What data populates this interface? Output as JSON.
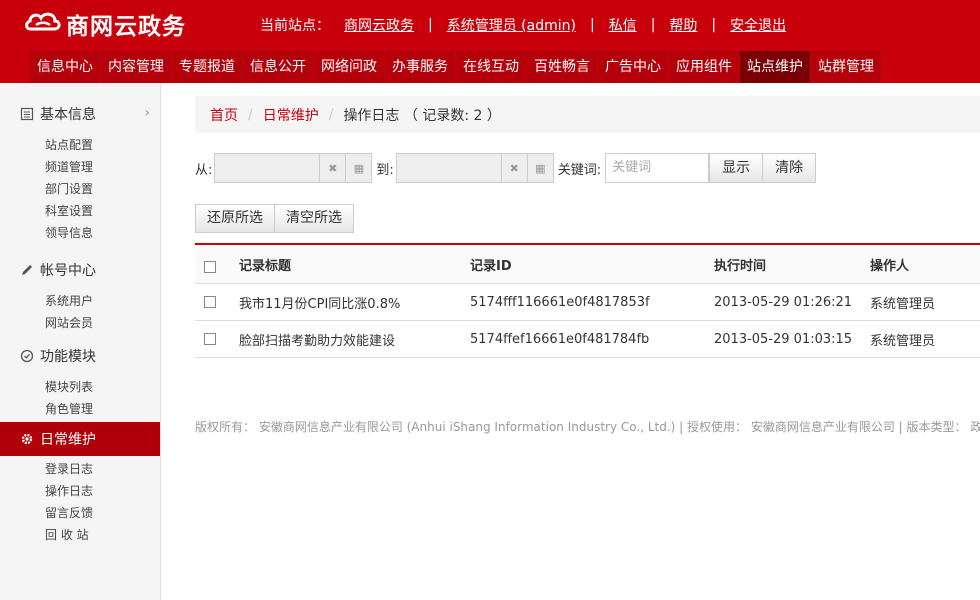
{
  "brand": {
    "name": "商网云政务",
    "logo_icon": "cloud-logo-icon"
  },
  "topnav": {
    "site_label": "当前站点：",
    "site_name": "商网云政务",
    "user": "系统管理员 (admin)",
    "message": "私信",
    "help": "帮助",
    "logout": "安全退出",
    "sep": "|"
  },
  "mainnav": [
    {
      "label": "信息中心"
    },
    {
      "label": "内容管理"
    },
    {
      "label": "专题报道"
    },
    {
      "label": "信息公开"
    },
    {
      "label": "网络问政"
    },
    {
      "label": "办事服务"
    },
    {
      "label": "在线互动"
    },
    {
      "label": "百姓畅言"
    },
    {
      "label": "广告中心"
    },
    {
      "label": "应用组件"
    },
    {
      "label": "站点维护",
      "active": true
    },
    {
      "label": "站群管理"
    }
  ],
  "sidebar": {
    "sections": [
      {
        "title": "基本信息",
        "icon": "list-icon",
        "items": [
          "站点配置",
          "频道管理",
          "部门设置",
          "科室设置",
          "领导信息"
        ]
      },
      {
        "title": "帐号中心",
        "icon": "pencil-icon",
        "items": [
          "系统用户",
          "网站会员"
        ]
      },
      {
        "title": "功能模块",
        "icon": "check-circle-icon",
        "items": [
          "模块列表",
          "角色管理"
        ]
      },
      {
        "title": "日常维护",
        "icon": "gear-icon",
        "items": [
          "登录日志",
          "操作日志",
          "留言反馈",
          "回 收 站"
        ]
      }
    ]
  },
  "breadcrumb": {
    "home": "首页",
    "section": "日常维护",
    "current": "操作日志 （ 记录数: 2 ）",
    "divider": "/"
  },
  "filter": {
    "from_label": "从:",
    "to_label": "到:",
    "keyword_label": "关键词:",
    "keyword_placeholder": "关键词",
    "show_button": "显示",
    "clear_button": "清除",
    "clear_icon": "✖",
    "calendar_icon": "▦"
  },
  "actions": {
    "restore": "还原所选",
    "clear_selection": "清空所选"
  },
  "table": {
    "columns": [
      "记录标题",
      "记录ID",
      "执行时间",
      "操作人"
    ],
    "rows": [
      {
        "title": "我市11月份CPI同比涨0.8%",
        "id": "5174fff116661e0f4817853f",
        "time": "2013-05-29 01:26:21",
        "operator": "系统管理员"
      },
      {
        "title": "脸部扫描考勤助力效能建设",
        "id": "5174ffef16661e0f481784fb",
        "time": "2013-05-29 01:03:15",
        "operator": "系统管理员"
      }
    ]
  },
  "footer": {
    "text": "版权所有： 安徽商网信息产业有限公司 (Anhui iShang Information Industry Co., Ltd.) | 授权使用： 安徽商网信息产业有限公司 | 版本类型： 政"
  }
}
